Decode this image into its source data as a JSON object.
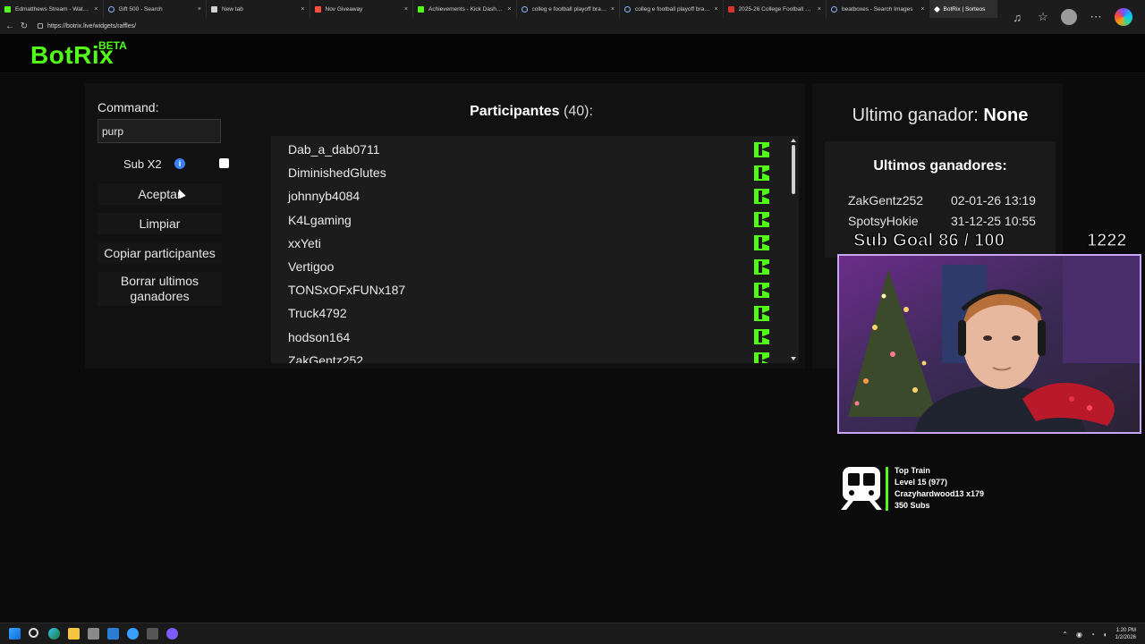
{
  "browser": {
    "tabs": [
      {
        "title": "Edmatthews Stream - Watch Live",
        "icon": "kick"
      },
      {
        "title": "Gift 500 - Search",
        "icon": "search"
      },
      {
        "title": "New tab",
        "icon": "page"
      },
      {
        "title": "Nov Giveaway",
        "icon": "giveaway"
      },
      {
        "title": "Achievements - Kick Dashboard",
        "icon": "kick"
      },
      {
        "title": "colleg e football playoff bracket",
        "icon": "search"
      },
      {
        "title": "colleg e football playoff bracket",
        "icon": "search"
      },
      {
        "title": "2025-26 College Football Playoff",
        "icon": "espn"
      },
      {
        "title": "beatboxes - Search Images",
        "icon": "search"
      },
      {
        "title": "BotRix | Sorteos",
        "icon": "botrix",
        "active": true
      }
    ],
    "url": "https://botrix.live/widgets/raffles/"
  },
  "app": {
    "logo": "BotRix",
    "logo_badge": "BETA",
    "accent_color": "#53fc18"
  },
  "controls": {
    "command_label": "Command:",
    "command_value": "purp",
    "sub_x2_label": "Sub X2",
    "sub_x2_checked": false,
    "aceptar": "Aceptar",
    "limpiar": "Limpiar",
    "copiar": "Copiar participantes",
    "borrar": "Borrar ultimos ganadores"
  },
  "participants": {
    "title": "Participantes",
    "count": "(40):",
    "items": [
      "Dab_a_dab0711",
      "DiminishedGlutes",
      "johnnyb4084",
      "K4Lgaming",
      "xxYeti",
      "Vertigoo",
      "TONSxOFxFUNx187",
      "Truck4792",
      "hodson164",
      "ZakGentz252"
    ]
  },
  "winners": {
    "last_label": "Ultimo ganador:",
    "last_value": "None",
    "list_title": "Ultimos ganadores:",
    "rows": [
      {
        "name": "ZakGentz252",
        "date": "02-01-26 13:19"
      },
      {
        "name": "SpotsyHokie",
        "date": "31-12-25 10:55"
      }
    ]
  },
  "overlay": {
    "sub_goal": "Sub Goal  86 / 100",
    "sub_count": "1222",
    "train": {
      "title": "Top Train",
      "level": "Level 15  (977)",
      "top": "Crazyhardwood13 x179",
      "subs": "350 Subs"
    }
  },
  "taskbar": {
    "time": "1:20 PM",
    "date": "1/2/2026"
  }
}
